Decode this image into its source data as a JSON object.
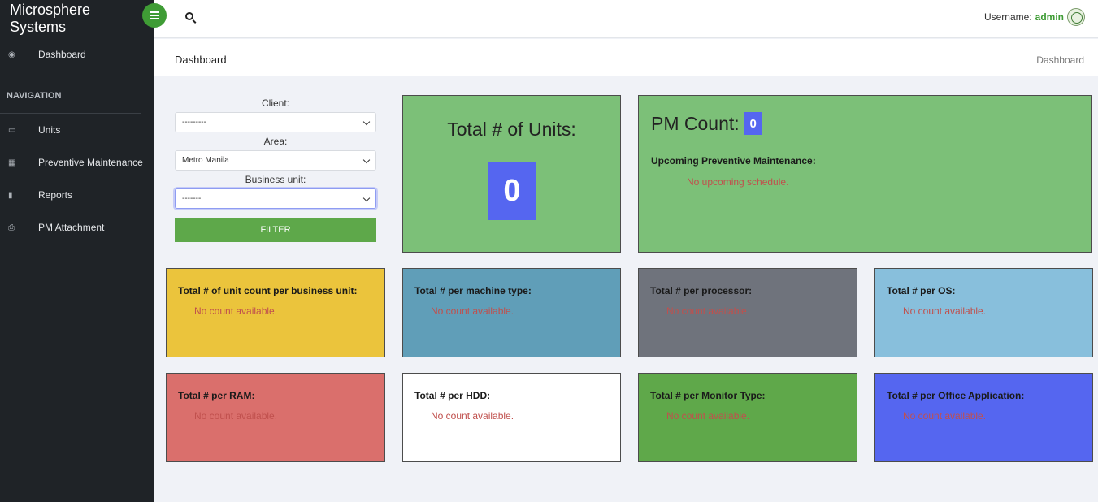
{
  "sidebar": {
    "brand": "Microsphere Systems",
    "items": [
      {
        "label": "Dashboard",
        "icon": "dashboard-icon"
      },
      {
        "label": "Units",
        "icon": "laptop-icon"
      },
      {
        "label": "Preventive Maintenance",
        "icon": "calendar-icon"
      },
      {
        "label": "Reports",
        "icon": "book-icon"
      },
      {
        "label": "PM Attachment",
        "icon": "print-icon"
      }
    ],
    "section_header": "NAVIGATION"
  },
  "topbar": {
    "username_label": "Username:",
    "username": "admin"
  },
  "page": {
    "title": "Dashboard",
    "breadcrumb": "Dashboard"
  },
  "filter": {
    "client_label": "Client:",
    "client_value": "---------",
    "area_label": "Area:",
    "area_value": "Metro Manila",
    "business_unit_label": "Business unit:",
    "business_unit_value": "-------",
    "button_label": "FILTER"
  },
  "units_card": {
    "title": "Total # of Units:",
    "count": "0"
  },
  "pm_card": {
    "title": "PM Count:",
    "count": "0",
    "subtitle": "Upcoming Preventive Maintenance:",
    "message": "No upcoming schedule."
  },
  "stat_cards": [
    {
      "title": "Total # of unit count per business unit:",
      "message": "No count available.",
      "color": "#ebc43c"
    },
    {
      "title": "Total # per machine type:",
      "message": "No count available.",
      "color": "#609eb8"
    },
    {
      "title": "Total # per processor:",
      "message": "No count available.",
      "color": "#6f737c"
    },
    {
      "title": "Total # per OS:",
      "message": "No count available.",
      "color": "#88bfdc"
    },
    {
      "title": "Total # per RAM:",
      "message": "No count available.",
      "color": "#da6f6c"
    },
    {
      "title": "Total # per HDD:",
      "message": "No count available.",
      "color": "#ffffff"
    },
    {
      "title": "Total # per Monitor Type:",
      "message": "No count available.",
      "color": "#5fa84a"
    },
    {
      "title": "Total # per Office Application:",
      "message": "No count available.",
      "color": "#5566f0"
    }
  ],
  "colors": {
    "sidebar_bg": "#1f2327",
    "accent_green": "#3f9c35",
    "badge_blue": "#5566f0",
    "card_green": "#7cc078",
    "message_red": "#c0504d"
  }
}
